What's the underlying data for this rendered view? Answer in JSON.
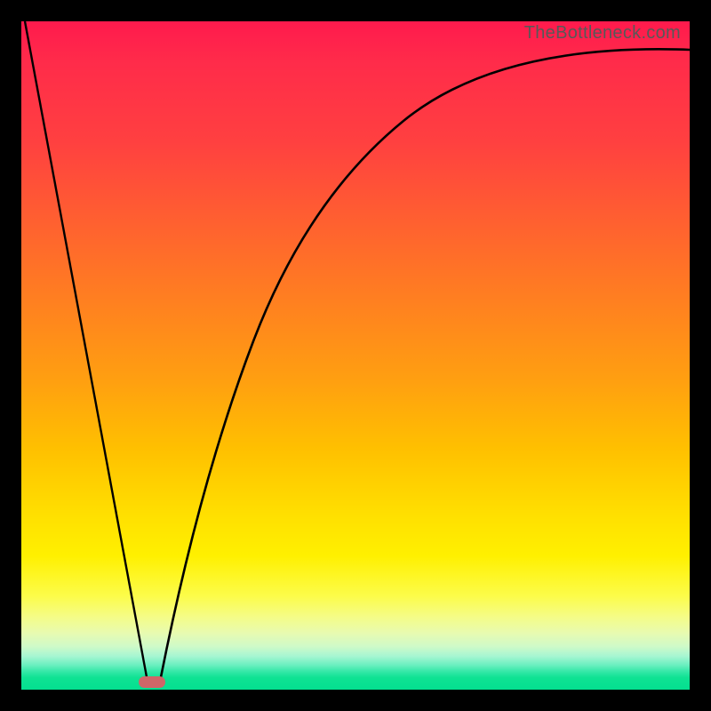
{
  "watermark": "TheBottleneck.com",
  "colors": {
    "frame": "#000000",
    "curve": "#000000",
    "marker": "#cf6668",
    "gradient_top": "#ff1a4d",
    "gradient_bottom": "#04e090"
  },
  "chart_data": {
    "type": "line",
    "title": "",
    "xlabel": "",
    "ylabel": "",
    "xlim": [
      0,
      1
    ],
    "ylim": [
      0,
      1
    ],
    "annotations": [
      "TheBottleneck.com"
    ],
    "series": [
      {
        "name": "left-descent",
        "x": [
          0.005,
          0.188
        ],
        "values": [
          1.0,
          0.012
        ]
      },
      {
        "name": "right-rise",
        "x": [
          0.208,
          0.225,
          0.246,
          0.268,
          0.292,
          0.318,
          0.347,
          0.379,
          0.414,
          0.452,
          0.495,
          0.541,
          0.593,
          0.649,
          0.711,
          0.78,
          0.855,
          0.938,
          1.0
        ],
        "values": [
          0.012,
          0.095,
          0.186,
          0.278,
          0.366,
          0.449,
          0.527,
          0.598,
          0.662,
          0.719,
          0.769,
          0.812,
          0.848,
          0.879,
          0.904,
          0.924,
          0.94,
          0.952,
          0.958
        ]
      }
    ],
    "marker": {
      "x": 0.195,
      "y": 0.006
    }
  }
}
